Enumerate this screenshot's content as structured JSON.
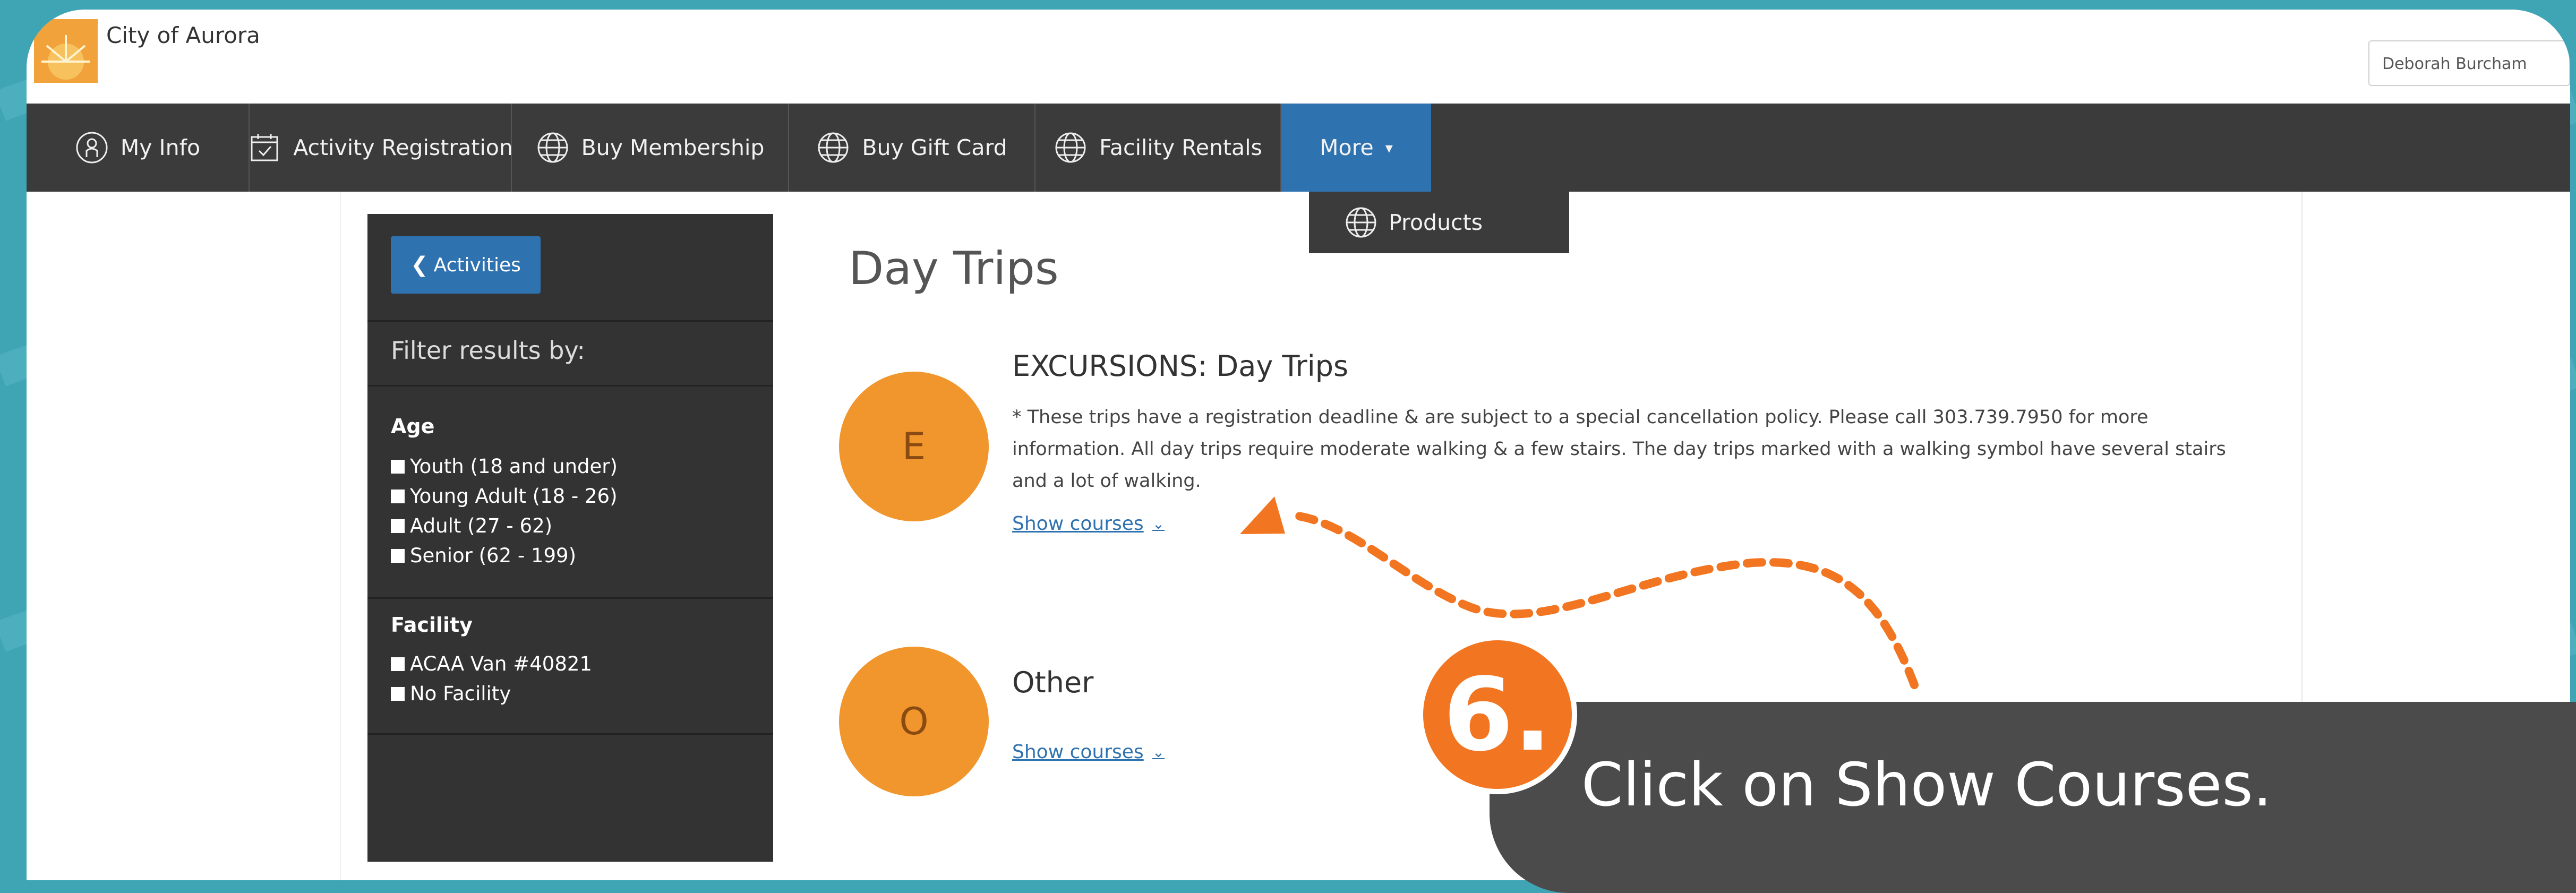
{
  "header": {
    "city_name": "City of Aurora",
    "user_name": "Deborah Burcham"
  },
  "nav": {
    "items": [
      {
        "label": "My Info",
        "icon": "person-icon"
      },
      {
        "label": "Activity Registration",
        "icon": "calendar-icon"
      },
      {
        "label": "Buy Membership",
        "icon": "globe-icon"
      },
      {
        "label": "Buy Gift Card",
        "icon": "globe-icon"
      },
      {
        "label": "Facility Rentals",
        "icon": "globe-icon"
      }
    ],
    "more_label": "More",
    "more_caret": "▾",
    "dropdown_item": "Products"
  },
  "sidebar": {
    "back_label": "Activities",
    "filter_title": "Filter results by:",
    "age_title": "Age",
    "age_options": [
      "Youth (18 and under)",
      "Young Adult (18 - 26)",
      "Adult (27 - 62)",
      "Senior (62 - 199)"
    ],
    "facility_title": "Facility",
    "facility_options": [
      "ACAA Van #40821",
      "No Facility"
    ]
  },
  "main": {
    "page_title": "Day Trips",
    "categories": [
      {
        "letter": "E",
        "title": "EXCURSIONS: Day Trips",
        "description": "* These trips have a registration deadline & are subject to a special cancellation policy. Please call 303.739.7950 for more information. All day trips require moderate walking & a few stairs. The day trips marked with a walking symbol have several stairs and a lot of walking.",
        "link": "Show courses"
      },
      {
        "letter": "O",
        "title": "Other",
        "link": "Show courses"
      }
    ]
  },
  "annotation": {
    "step": "6.",
    "instruction": "Click on Show Courses."
  },
  "colors": {
    "nav_bg": "#3b3b3b",
    "accent_blue": "#2f72b0",
    "circle_orange": "#f0962d",
    "badge_orange": "#f27521",
    "background_teal": "#3fa4b4"
  }
}
